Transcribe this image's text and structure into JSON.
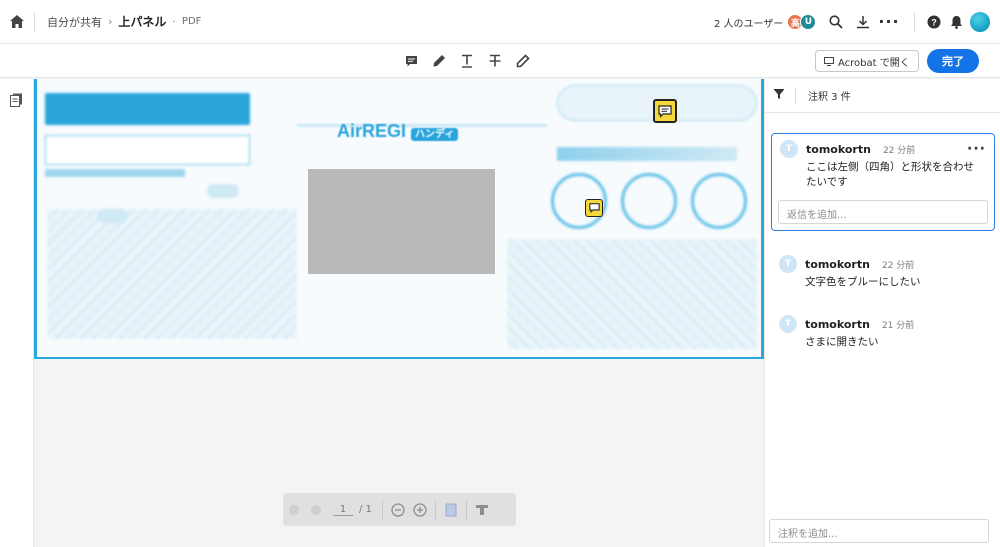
{
  "header": {
    "breadcrumb_root": "自分が共有",
    "file_title": "上パネル",
    "file_type": "PDF",
    "users_label": "2 人のユーザー",
    "avatar1": "高",
    "avatar2": "U"
  },
  "toolbar": {
    "open_in_acrobat": "Acrobat で開く",
    "done": "完了"
  },
  "document": {
    "logo_text": "AirREGI",
    "logo_badge": "ハンディ"
  },
  "pager": {
    "current_page": "1",
    "total_pages": "/ 1"
  },
  "comments_panel": {
    "count_label": "注釈 3 件",
    "add_comment_placeholder": "注釈を追加...",
    "comments": [
      {
        "avatar": "T",
        "user": "tomokortn",
        "time": "22 分前",
        "text": "ここは左側（四角）と形状を合わせたいです",
        "reply_placeholder": "返信を追加..."
      },
      {
        "avatar": "T",
        "user": "tomokortn",
        "time": "22 分前",
        "text": "文字色をブルーにしたい"
      },
      {
        "avatar": "T",
        "user": "tomokortn",
        "time": "21 分前",
        "text": "さまに開きたい"
      }
    ]
  },
  "colors": {
    "accent": "#1473e6",
    "doc_frame": "#29a8de",
    "note_pin": "#f4d83b"
  }
}
